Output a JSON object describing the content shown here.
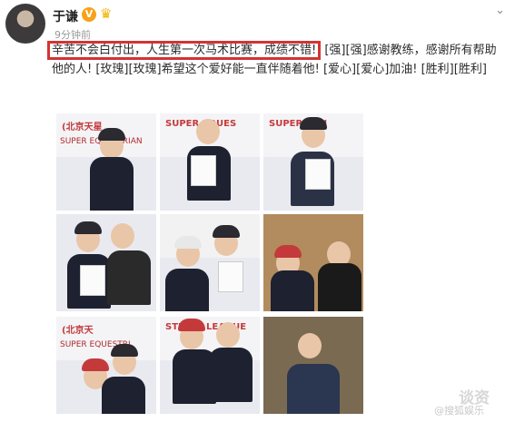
{
  "user": {
    "name": "于谦",
    "verified": "V",
    "time": "9分钟前"
  },
  "post": {
    "highlighted": "辛苦不会白付出，人生第一次马术比赛，成绩不错!",
    "rest": "[强][强]感谢教练，感谢所有帮助他的人! [玫瑰][玫瑰]希望这个爱好能一直伴随着他! [爱心][爱心]加油! [胜利][胜利]"
  },
  "photos": [
    {
      "banner": "(北京天星",
      "banner2": "SUPER EQUESTRIAN"
    },
    {
      "banner": "SUPER EQUES",
      "banner2": ""
    },
    {
      "banner": "SUPER EQU",
      "banner2": ""
    },
    {
      "banner": "",
      "banner2": ""
    },
    {
      "banner": "",
      "banner2": ""
    },
    {
      "banner": "",
      "banner2": ""
    },
    {
      "banner": "(北京天",
      "banner2": "SUPER EQUESTRI"
    },
    {
      "banner": "STRIAN LEAGUE",
      "banner2": ""
    },
    {
      "banner": "",
      "banner2": ""
    }
  ],
  "watermark": {
    "main": "谈资",
    "sub": "@搜狐娱乐"
  },
  "icons": {
    "verified": "verified-v-icon",
    "crown": "crown-icon",
    "menu": "chevron-down-icon"
  }
}
